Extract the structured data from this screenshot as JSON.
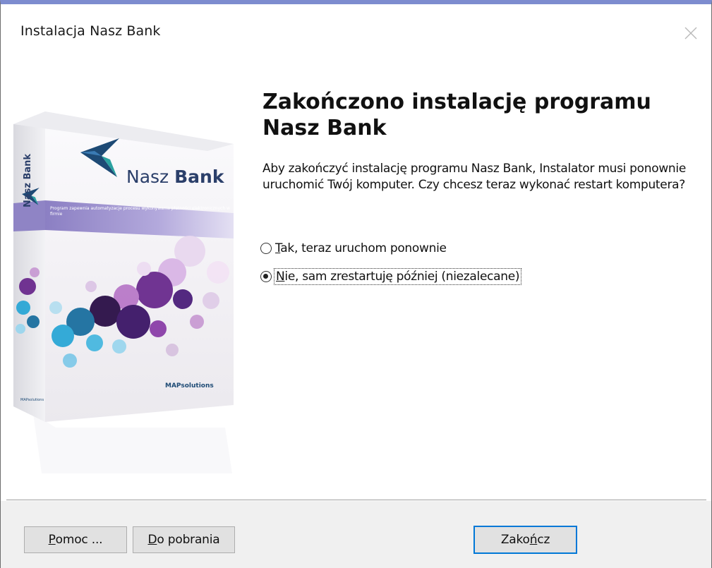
{
  "window": {
    "title": "Instalacja Nasz Bank"
  },
  "product": {
    "logo_text": "Nasz Bank",
    "logo_text_plain": "Nasz ",
    "logo_text_bold": "Bank",
    "spine_text": "Nasz Bank",
    "tagline": "Program zapewnia automatyzacje procesu wykonywania płatności elektronicznych w firmie",
    "vendor_logo": "MAPsolutions"
  },
  "main": {
    "heading_line1": "Zakończono instalację programu",
    "heading_line2": "Nasz Bank",
    "description": "Aby zakończyć instalację programu Nasz Bank, Instalator musi ponownie uruchomić Twój komputer. Czy chcesz teraz wykonać restart komputera?",
    "options": [
      {
        "label_mnemonic": "T",
        "label_rest": "ak, teraz uruchom ponownie",
        "selected": false
      },
      {
        "label_mnemonic": "N",
        "label_rest": "ie, sam zrestartuję później (niezalecane)",
        "selected": true
      }
    ]
  },
  "footer": {
    "help_mnemonic": "P",
    "help_rest": "omoc ...",
    "download_mnemonic": "D",
    "download_rest": "o pobrania",
    "finish_pre": "Zako",
    "finish_mnemonic": "ń",
    "finish_rest": "cz"
  },
  "colors": {
    "title_accent": "#7d8ccf",
    "focus_border": "#0078d7",
    "footer_bg": "#f0f0f0"
  },
  "icons": {
    "close": "close-icon",
    "radio_unchecked": "radio-unchecked-icon",
    "radio_checked": "radio-checked-icon"
  }
}
